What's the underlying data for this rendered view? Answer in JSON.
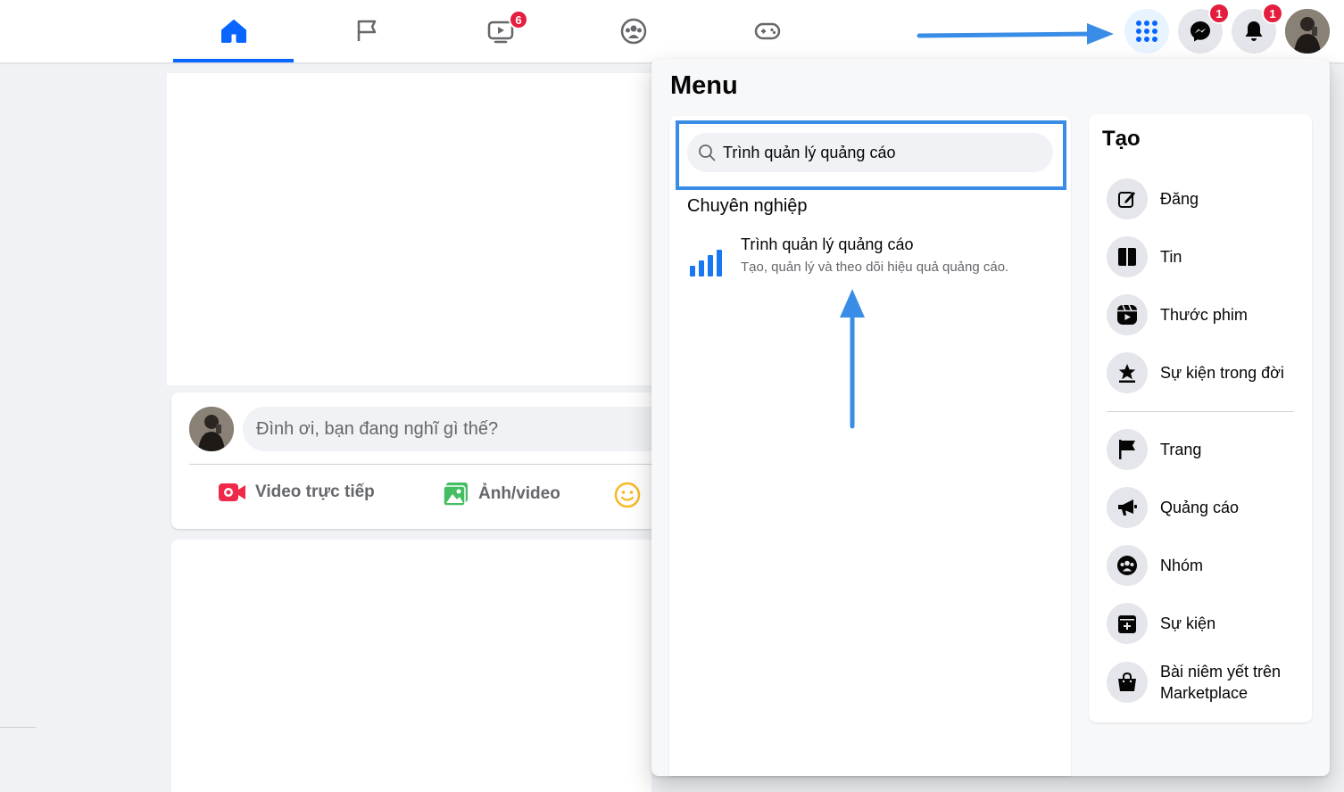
{
  "nav": {
    "tabs": [
      {
        "name": "home",
        "active": true
      },
      {
        "name": "pages"
      },
      {
        "name": "watch",
        "badge": "6"
      },
      {
        "name": "groups"
      },
      {
        "name": "gaming"
      }
    ],
    "messenger_badge": "1",
    "notifications_badge": "1"
  },
  "composer": {
    "placeholder": "Đình ơi, bạn đang nghĩ gì thế?",
    "live_video": "Video trực tiếp",
    "photo_video": "Ảnh/video"
  },
  "menu": {
    "title": "Menu",
    "search_value": "Trình quản lý quảng cáo",
    "section": "Chuyên nghiệp",
    "result_title": "Trình quản lý quảng cáo",
    "result_desc": "Tạo, quản lý và theo dõi hiệu quả quảng cáo.",
    "create": {
      "title": "Tạo",
      "items": [
        "Đăng",
        "Tin",
        "Thước phim",
        "Sự kiện trong đời",
        "Trang",
        "Quảng cáo",
        "Nhóm",
        "Sự kiện",
        "Bài niêm yết trên Marketplace"
      ]
    }
  },
  "colors": {
    "accent": "#0866ff",
    "badge": "#e41e3f",
    "annotation": "#3a8de6"
  }
}
